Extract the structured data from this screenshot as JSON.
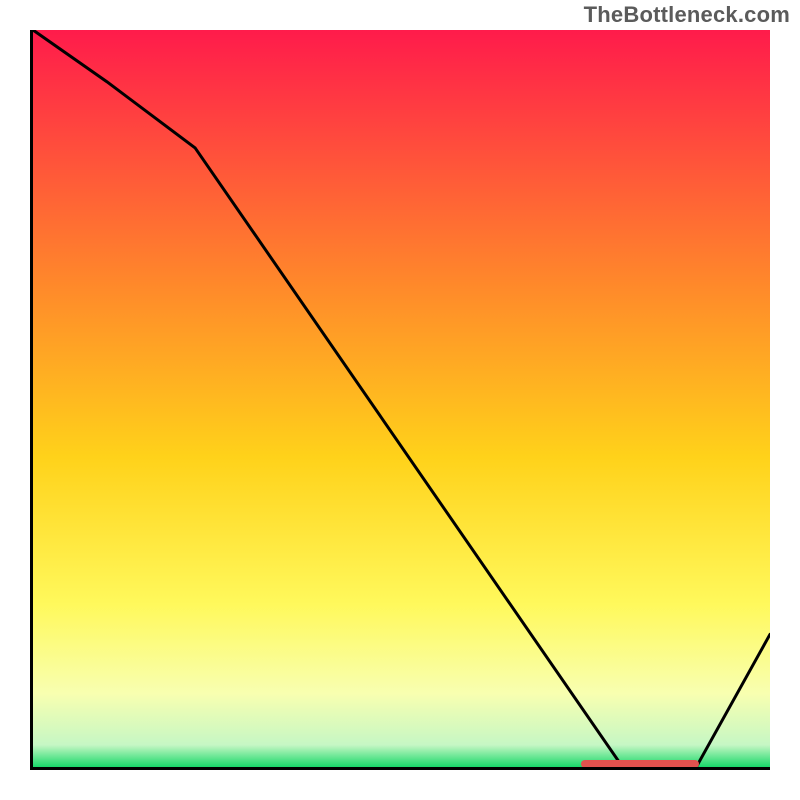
{
  "attribution": "TheBottleneck.com",
  "chart_data": {
    "type": "line",
    "title": "",
    "xlabel": "",
    "ylabel": "",
    "xlim": [
      0,
      100
    ],
    "ylim": [
      0,
      100
    ],
    "grid": false,
    "legend": false,
    "annotations": [],
    "x": [
      0,
      10,
      22,
      80,
      90,
      100
    ],
    "values": [
      100,
      93,
      84,
      0,
      0,
      18
    ],
    "optimum_band_x": [
      74,
      90
    ],
    "background_gradient_stops": [
      {
        "pct": 0,
        "color": "#ff1b4b"
      },
      {
        "pct": 35,
        "color": "#ff8a2a"
      },
      {
        "pct": 58,
        "color": "#ffd21a"
      },
      {
        "pct": 78,
        "color": "#fff95c"
      },
      {
        "pct": 90,
        "color": "#f8ffb0"
      },
      {
        "pct": 97,
        "color": "#c6f7c4"
      },
      {
        "pct": 100,
        "color": "#18d86a"
      }
    ]
  }
}
